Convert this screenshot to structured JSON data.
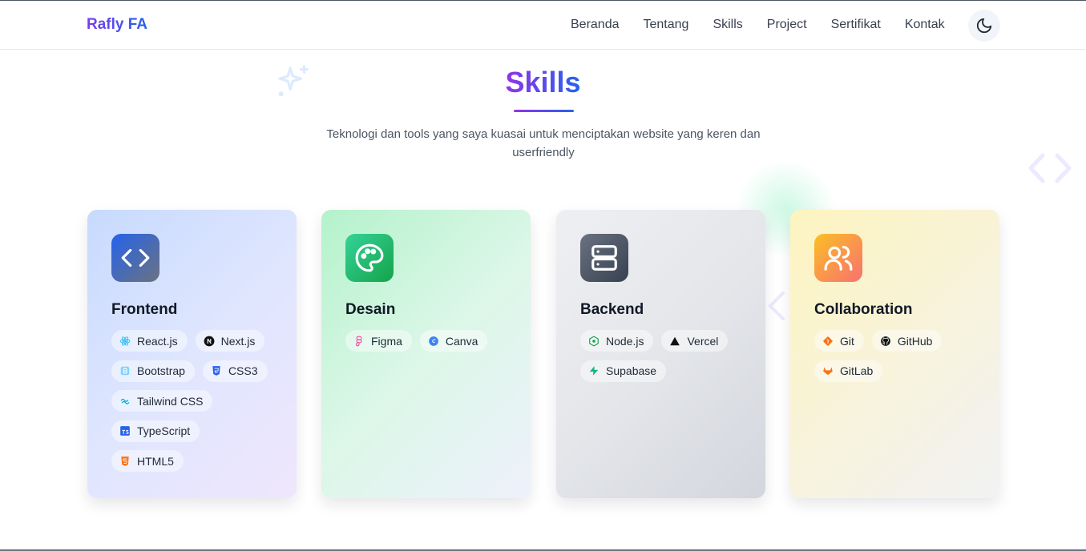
{
  "nav": {
    "brand": "Rafly FA",
    "links": [
      "Beranda",
      "Tentang",
      "Skills",
      "Project",
      "Sertifikat",
      "Kontak"
    ],
    "theme_icon": "moon-icon"
  },
  "section": {
    "title": "Skills",
    "subtitle": "Teknologi dan tools yang saya kuasai untuk menciptakan website yang keren dan userfriendly"
  },
  "cards": [
    {
      "title": "Frontend",
      "icon": "code-icon",
      "skills": [
        "React.js",
        "Next.js",
        "Bootstrap",
        "CSS3",
        "Tailwind CSS",
        "TypeScript",
        "HTML5"
      ]
    },
    {
      "title": "Desain",
      "icon": "palette-icon",
      "skills": [
        "Figma",
        "Canva"
      ]
    },
    {
      "title": "Backend",
      "icon": "server-icon",
      "skills": [
        "Node.js",
        "Vercel",
        "Supabase"
      ]
    },
    {
      "title": "Collaboration",
      "icon": "users-icon",
      "skills": [
        "Git",
        "GitHub",
        "GitLab"
      ]
    }
  ],
  "colors": {
    "accent_purple": "#9333ea",
    "accent_blue": "#2563eb"
  }
}
